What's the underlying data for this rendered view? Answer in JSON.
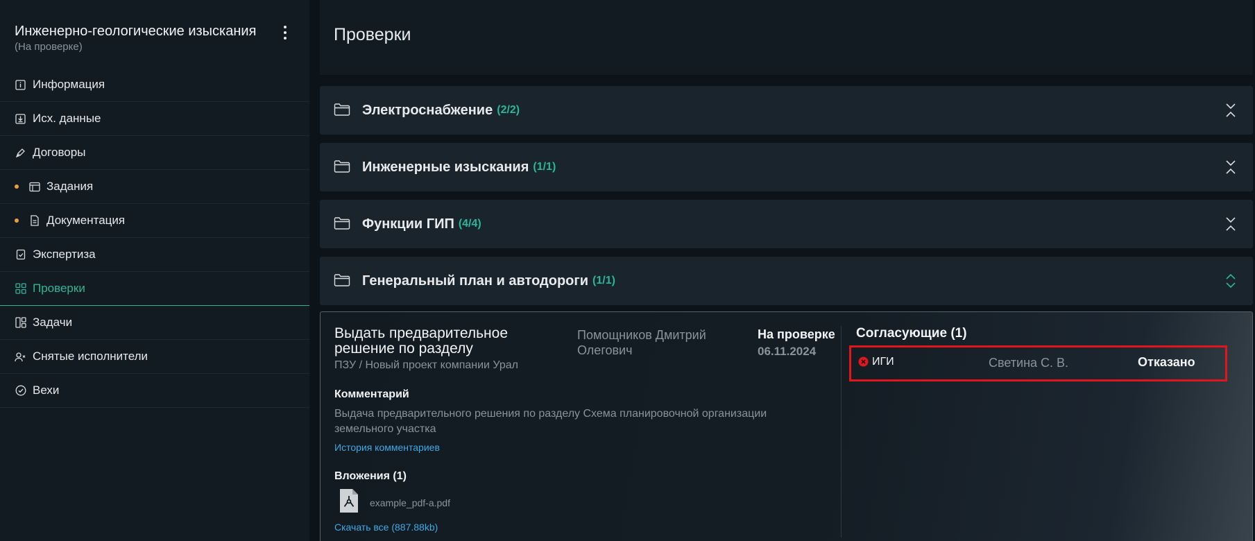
{
  "sidebar": {
    "project_title": "Инженерно-геологические изыскания",
    "project_status": "(На проверке)",
    "items": [
      {
        "label": "Информация",
        "icon": "info-icon",
        "dot": false,
        "active": false
      },
      {
        "label": "Исх. данные",
        "icon": "download-icon",
        "dot": false,
        "active": false
      },
      {
        "label": "Договоры",
        "icon": "pen-icon",
        "dot": false,
        "active": false
      },
      {
        "label": "Задания",
        "icon": "window-icon",
        "dot": true,
        "active": false
      },
      {
        "label": "Документация",
        "icon": "document-icon",
        "dot": true,
        "active": false
      },
      {
        "label": "Экспертиза",
        "icon": "checklist-icon",
        "dot": false,
        "active": false
      },
      {
        "label": "Проверки",
        "icon": "grid-icon",
        "dot": false,
        "active": true
      },
      {
        "label": "Задачи",
        "icon": "board-icon",
        "dot": false,
        "active": false
      },
      {
        "label": "Снятые исполнители",
        "icon": "user-remove-icon",
        "dot": false,
        "active": false
      },
      {
        "label": "Вехи",
        "icon": "check-circle-icon",
        "dot": false,
        "active": false
      }
    ]
  },
  "main": {
    "page_title": "Проверки",
    "groups": [
      {
        "name": "Электроснабжение",
        "count": "(2/2)",
        "expanded": false
      },
      {
        "name": "Инженерные изыскания",
        "count": "(1/1)",
        "expanded": false
      },
      {
        "name": "Функции ГИП",
        "count": "(4/4)",
        "expanded": false
      },
      {
        "name": "Генеральный план и автодороги",
        "count": "(1/1)",
        "expanded": true
      }
    ],
    "task": {
      "title": "Выдать предварительное решение по разделу",
      "path": "ПЗУ / Новый проект компании Урал",
      "assignee": "Помощников Дмитрий Олегович",
      "status": "На проверке",
      "date": "06.11.2024",
      "comment_label": "Комментарий",
      "comment": "Выдача предварительного решения по разделу Схема планировочной организации земельного участка",
      "comment_history_link": "История комментариев",
      "attachments_label": "Вложения (1)",
      "file_name": "example_pdf-a.pdf",
      "download_all_link": "Скачать все (887.88kb)",
      "approvers_label": "Согласующие (1)",
      "approver": {
        "code": "ИГИ",
        "name": "Светина С. В.",
        "status": "Отказано"
      }
    }
  },
  "colors": {
    "accent": "#2bb59a",
    "link": "#3fa9e6",
    "dot": "#e8a13a",
    "reject": "#e0161f"
  }
}
